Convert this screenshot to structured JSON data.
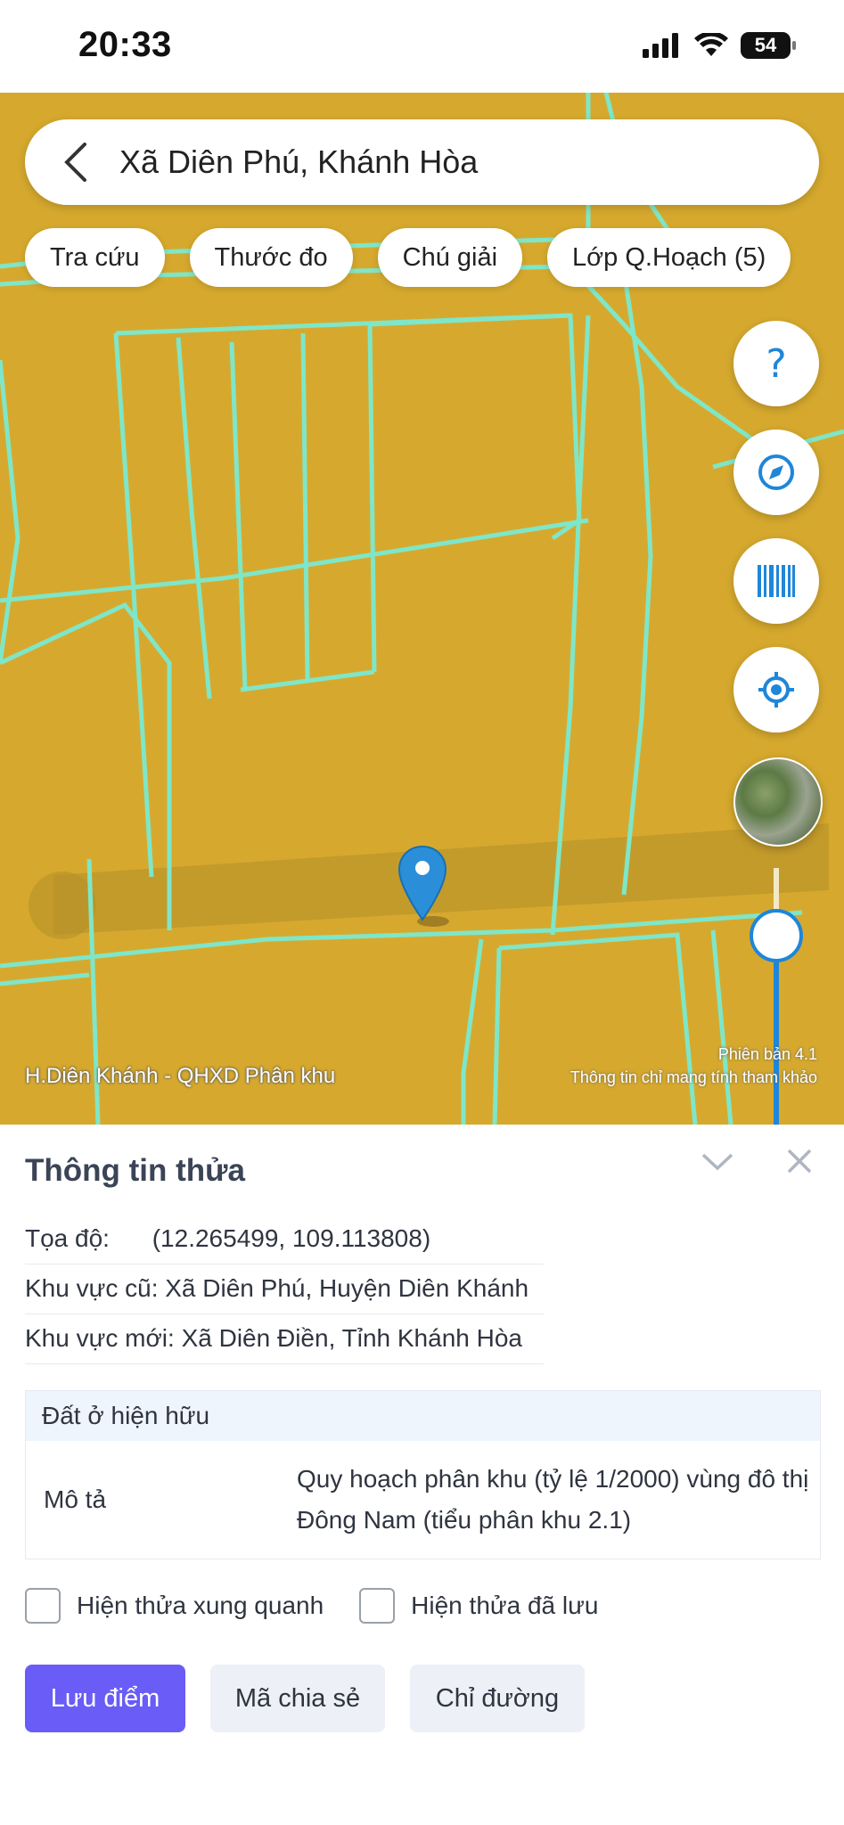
{
  "status_bar": {
    "time": "20:33",
    "battery": "54"
  },
  "search": {
    "query": "Xã Diên Phú, Khánh Hòa"
  },
  "chips": [
    "Tra cứu",
    "Thước đo",
    "Chú giải",
    "Lớp Q.Hoạch (5)"
  ],
  "map": {
    "layer_label": "H.Diên Khánh - QHXD Phân khu",
    "version": "Phiên bản 4.1",
    "disclaimer": "Thông tin chỉ mang tính tham khảo",
    "colors": {
      "land": "#d6a92e",
      "parcel_lines": "#7fe6c8",
      "accent": "#1f86d8"
    }
  },
  "right_controls": [
    "help-icon",
    "compass-icon",
    "barcode-icon",
    "locate-icon",
    "satellite-layer"
  ],
  "panel": {
    "title": "Thông tin thửa",
    "coords_label": "Tọa độ:",
    "coords_value": "(12.265499, 109.113808)",
    "old_area": "Khu vực cũ: Xã Diên Phú, Huyện Diên Khánh",
    "new_area": "Khu vực mới: Xã Diên Điền, Tỉnh Khánh Hòa",
    "land_type": "Đất ở hiện hữu",
    "desc_key": "Mô tả",
    "desc_value": "Quy hoạch phân khu (tỷ lệ 1/2000) vùng đô thị Đông Nam (tiểu phân khu 2.1)",
    "check_nearby": "Hiện thửa xung quanh",
    "check_saved": "Hiện thửa đã lưu",
    "btn_save": "Lưu điểm",
    "btn_share": "Mã chia sẻ",
    "btn_directions": "Chỉ đường"
  }
}
